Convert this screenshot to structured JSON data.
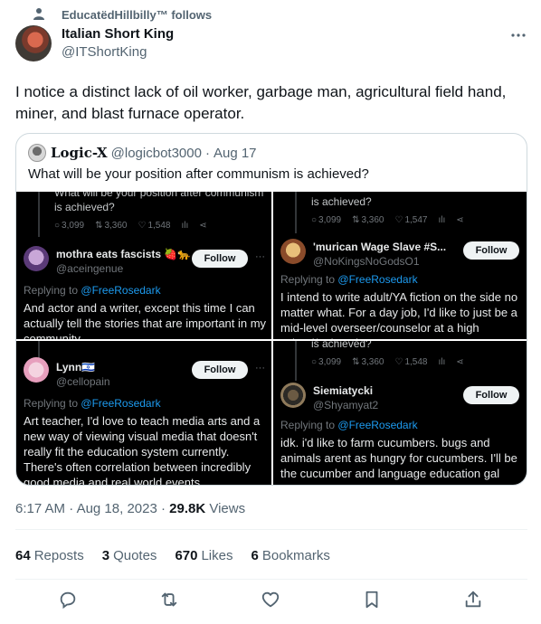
{
  "social_context": {
    "text": "EducatëdHillbilly™ follows"
  },
  "author": {
    "name": "Italian Short King",
    "handle": "@ITShortKing"
  },
  "tweet": {
    "text": "I notice a distinct lack of oil worker, garbage man, agricultural field hand, miner, and blast furnace operator."
  },
  "quote": {
    "name": "Logic-X",
    "handle": "@logicbot3000",
    "separator": "·",
    "date": "Aug 17",
    "text": "What will be your position after communism is achieved?"
  },
  "panels": [
    {
      "top_line_1": "What will be your position after communism",
      "top_line_2": "is achieved?",
      "stats": {
        "replies": "3,099",
        "reposts": "3,360",
        "likes": "1,548"
      },
      "name": "mothra eats fascists 🍓🐆",
      "handle": "@aceingenue",
      "follow": "Follow",
      "reply_prefix": "Replying to",
      "mention": "@FreeRosedark",
      "body": "And actor and a writer, except this time I can actually tell the stories that are important in my community"
    },
    {
      "top_line_2": "is achieved?",
      "stats": {
        "replies": "3,099",
        "reposts": "3,360",
        "likes": "1,547"
      },
      "name": "'murican Wage Slave #S...",
      "handle": "@NoKingsNoGodsO1",
      "follow": "Follow",
      "reply_prefix": "Replying to",
      "mention": "@FreeRosedark",
      "body": "I intend to write adult/YA fiction on the side no matter what.  For a day job, I'd like to just be a mid-level overseer/counselor at a high school/university"
    },
    {
      "name": "Lynn🇮🇱",
      "handle": "@cellopain",
      "follow": "Follow",
      "reply_prefix": "Replying to",
      "mention": "@FreeRosedark",
      "body": "Art teacher, I'd love to teach media arts and a new way of viewing visual media that doesn't really fit the education system currently. There's often correlation between incredibly good media and real world events"
    },
    {
      "top_line_2": "is achieved?",
      "stats": {
        "replies": "3,099",
        "reposts": "3,360",
        "likes": "1,548"
      },
      "name": "Siemiatycki",
      "handle": "@Shyamyat2",
      "follow": "Follow",
      "reply_prefix": "Replying to",
      "mention": "@FreeRosedark",
      "body": "idk. i'd like to farm cucumbers. bugs and animals arent as hungry for cucumbers. I'll be the cucumber and language education gal"
    }
  ],
  "meta": {
    "time": "6:17 AM",
    "dot1": "·",
    "date": "Aug 18, 2023",
    "dot2": "·",
    "views": "29.8K",
    "views_label": "Views"
  },
  "stats": {
    "reposts": "64",
    "reposts_label": "Reposts",
    "quotes": "3",
    "quotes_label": "Quotes",
    "likes": "670",
    "likes_label": "Likes",
    "bookmarks": "6",
    "bookmarks_label": "Bookmarks"
  },
  "icons": [
    "person-icon",
    "more-icon",
    "reply-icon",
    "repost-icon",
    "like-icon",
    "bookmark-icon",
    "share-icon",
    "views-icon"
  ],
  "colors": {
    "text": "#0f1419",
    "muted": "#536471",
    "accent": "#1d9bf0",
    "border": "#cfd9de",
    "panel_bg": "#000000"
  }
}
